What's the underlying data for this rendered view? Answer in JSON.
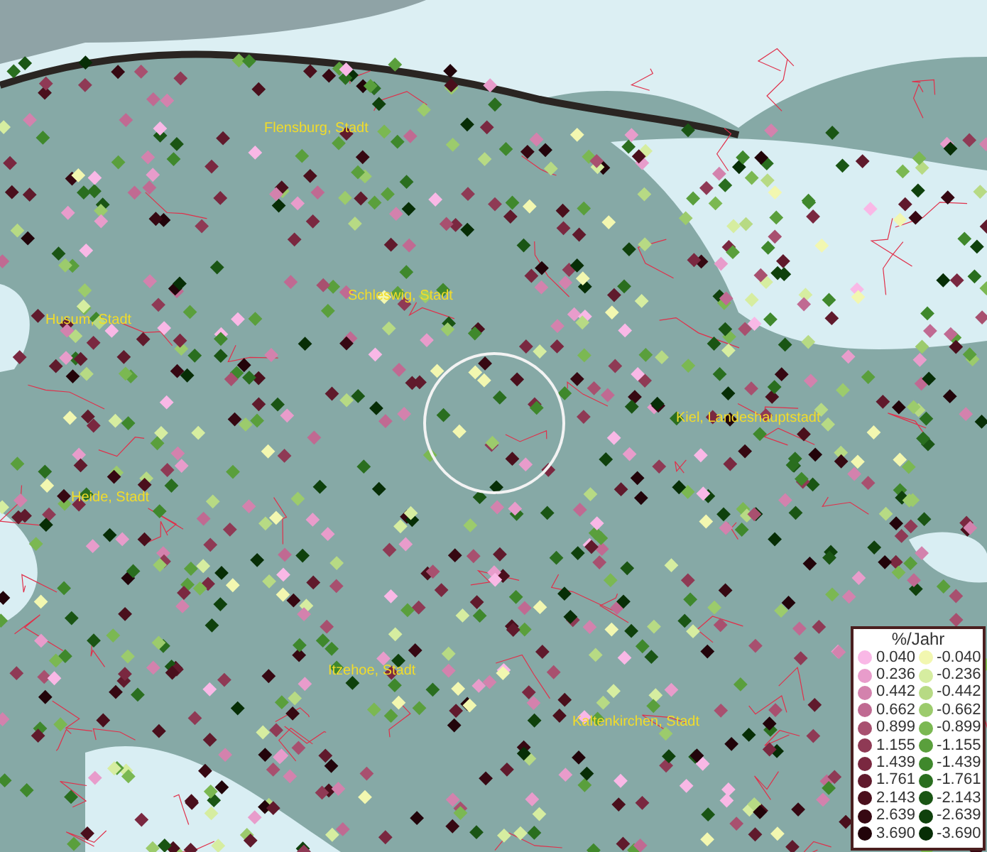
{
  "places": [
    {
      "label": "Flensburg, Stadt"
    },
    {
      "label": "Schleswig, Stadt"
    },
    {
      "label": "Husum, Stadt"
    },
    {
      "label": "Kiel, Landeshauptstadt"
    },
    {
      "label": "Heide, Stadt"
    },
    {
      "label": "Itzehoe, Stadt"
    },
    {
      "label": "Kaltenkirchen, Stadt"
    }
  ],
  "legend": {
    "title": "%/Jahr",
    "columns": [
      [
        {
          "label": "0.040",
          "color": "#f9b8e6"
        },
        {
          "label": "0.236",
          "color": "#e89ccb"
        },
        {
          "label": "0.442",
          "color": "#d382ad"
        },
        {
          "label": "0.662",
          "color": "#c06a92"
        },
        {
          "label": "0.899",
          "color": "#a8506f"
        },
        {
          "label": "1.155",
          "color": "#8f3a55"
        },
        {
          "label": "1.439",
          "color": "#7a2840"
        },
        {
          "label": "1.761",
          "color": "#601a2c"
        },
        {
          "label": "2.143",
          "color": "#4a0f1c"
        },
        {
          "label": "2.639",
          "color": "#360812"
        },
        {
          "label": "3.690",
          "color": "#22040a"
        }
      ],
      [
        {
          "label": "-0.040",
          "color": "#f2f7b0"
        },
        {
          "label": "-0.236",
          "color": "#d6eda0"
        },
        {
          "label": "-0.442",
          "color": "#b7da84"
        },
        {
          "label": "-0.662",
          "color": "#9ccb6c"
        },
        {
          "label": "-0.899",
          "color": "#7bb852"
        },
        {
          "label": "-1.155",
          "color": "#5a9f3c"
        },
        {
          "label": "-1.439",
          "color": "#3f882c"
        },
        {
          "label": "-1.761",
          "color": "#2a6e1f"
        },
        {
          "label": "-2.143",
          "color": "#1a5514"
        },
        {
          "label": "-2.639",
          "color": "#0f410c"
        },
        {
          "label": "-3.690",
          "color": "#072e06"
        }
      ]
    ]
  }
}
